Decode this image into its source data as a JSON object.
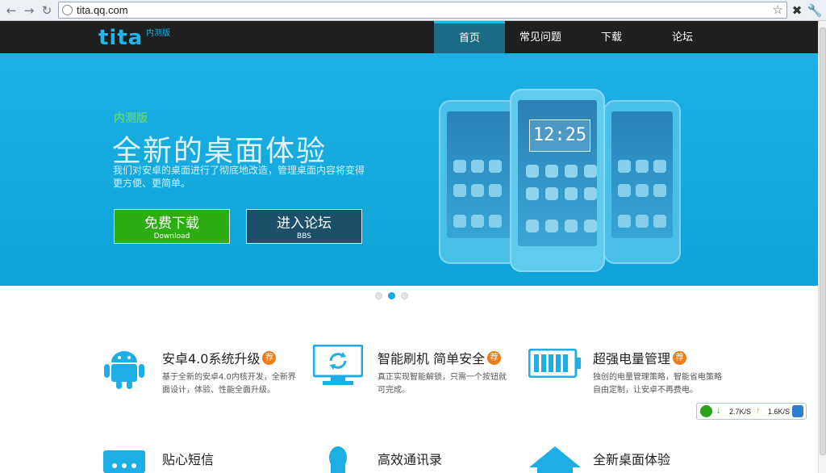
{
  "browser": {
    "url": "tita.qq.com",
    "back_icon": "arrow-left",
    "forward_icon": "arrow-right",
    "reload_icon": "reload"
  },
  "site": {
    "logo": "tita",
    "logo_badge": "内测版",
    "nav": [
      {
        "label": "首页",
        "active": true
      },
      {
        "label": "常见问题"
      },
      {
        "label": "下载"
      },
      {
        "label": "论坛"
      }
    ]
  },
  "hero": {
    "badge": "内测版",
    "title": "全新的桌面体验",
    "desc": "我们对安卓的桌面进行了彻底地改造，管理桌面内容将变得更方便、更简单。",
    "download_label": "免费下载",
    "download_sub": "Download",
    "forum_label": "进入论坛",
    "forum_sub": "BBS",
    "phone_clock": "12:25"
  },
  "carousel": {
    "count": 3,
    "active": 1
  },
  "features": [
    {
      "title": "安卓4.0系统升级",
      "badge": "荐",
      "desc": "基于全新的安卓4.0内核开发，全新界面设计，体验、性能全面升级。",
      "icon": "android-icon"
    },
    {
      "title": "智能刷机 简单安全",
      "badge": "荐",
      "desc": "真正实现智能解锁，只需一个按钮就可完成。",
      "icon": "monitor-refresh-icon"
    },
    {
      "title": "超强电量管理",
      "badge": "荐",
      "desc": "独创的电量管理策略，智能省电策略自由定制，让安卓不再费电。",
      "icon": "battery-icon"
    },
    {
      "title": "贴心短信",
      "icon": "message-icon"
    },
    {
      "title": "高效通讯录",
      "icon": "contact-icon"
    },
    {
      "title": "全新桌面体验",
      "icon": "home-icon"
    }
  ],
  "speed_widget": {
    "down": "2.7K/S",
    "up": "1.6K/S"
  },
  "colors": {
    "accent": "#1aa9de",
    "download_btn": "#2cae12",
    "header_bg": "#1f1f1f",
    "badge": "#f07a14"
  }
}
